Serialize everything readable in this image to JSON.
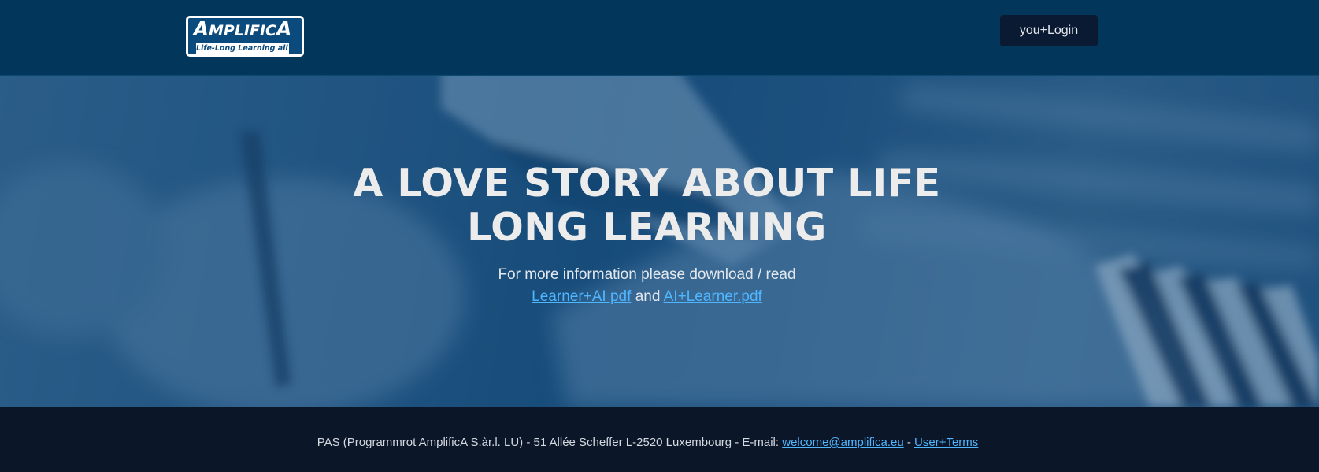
{
  "header": {
    "logo": {
      "word_first": "A",
      "word_middle": "MPLIFIC",
      "word_last": "A",
      "tagline": "Life-Long Learning all in"
    },
    "login_label": "you+Login"
  },
  "hero": {
    "title_line1": "A LOVE STORY ABOUT LIFE",
    "title_line2": "LONG LEARNING",
    "info_text": "For more information please download / read",
    "link1": "Learner+AI pdf",
    "conjunction": "and",
    "link2": "AI+Learner.pdf"
  },
  "footer": {
    "address": "PAS (Programmrot AmplificA S.àr.l. LU) - 51 Allée Scheffer L-2520 Luxembourg - E-mail:",
    "email": "welcome@amplifica.eu",
    "separator": "-",
    "terms": "User+Terms"
  },
  "colors": {
    "header_bg": "#02365a",
    "footer_bg": "#0b1629",
    "login_bg": "#0b1a33",
    "link": "#4fb6ff"
  }
}
